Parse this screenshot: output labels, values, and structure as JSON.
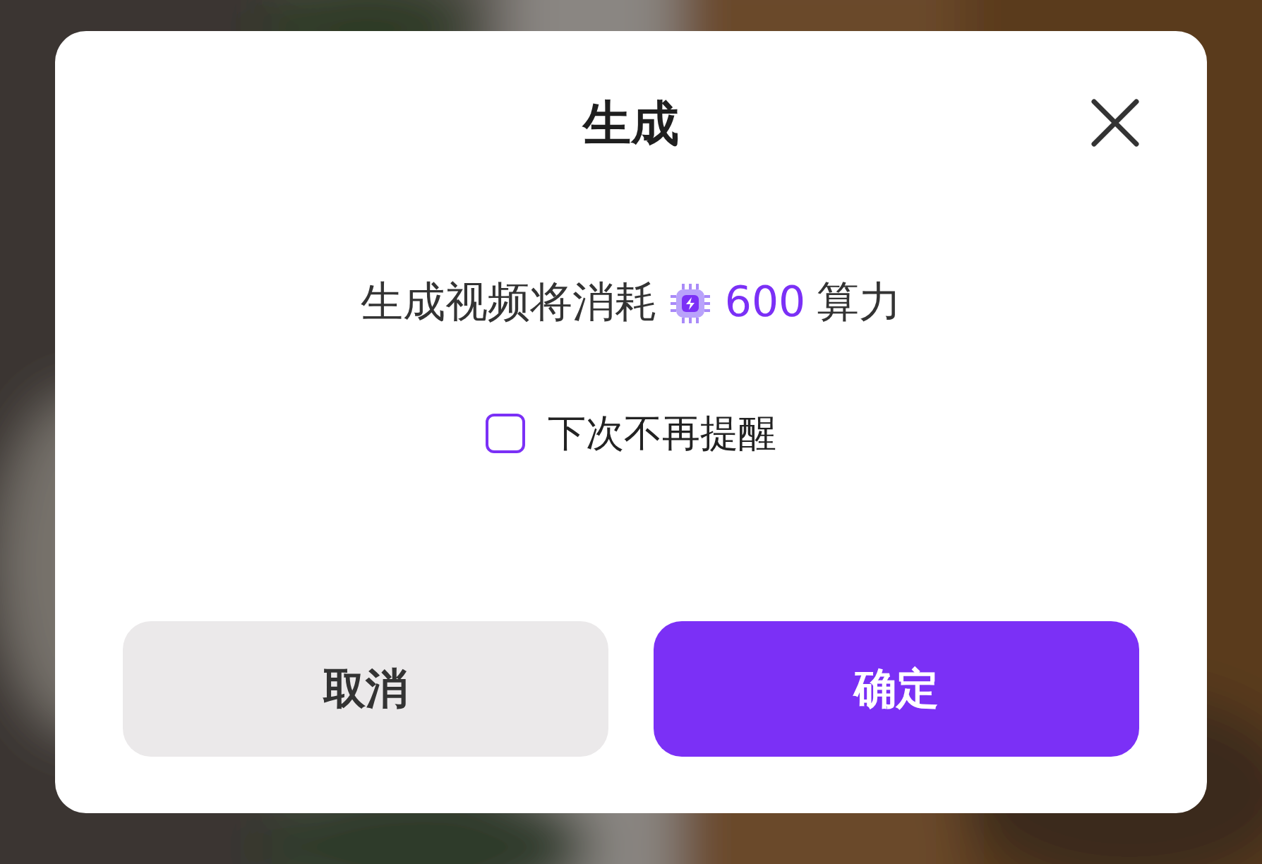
{
  "dialog": {
    "title": "生成",
    "message_prefix": "生成视频将消耗",
    "amount": "600",
    "unit": "算力"
  },
  "reminder": {
    "label": "下次不再提醒",
    "checked": false
  },
  "buttons": [
    {
      "label": "取消",
      "kind": "secondary"
    },
    {
      "label": "确定",
      "kind": "primary"
    }
  ]
}
